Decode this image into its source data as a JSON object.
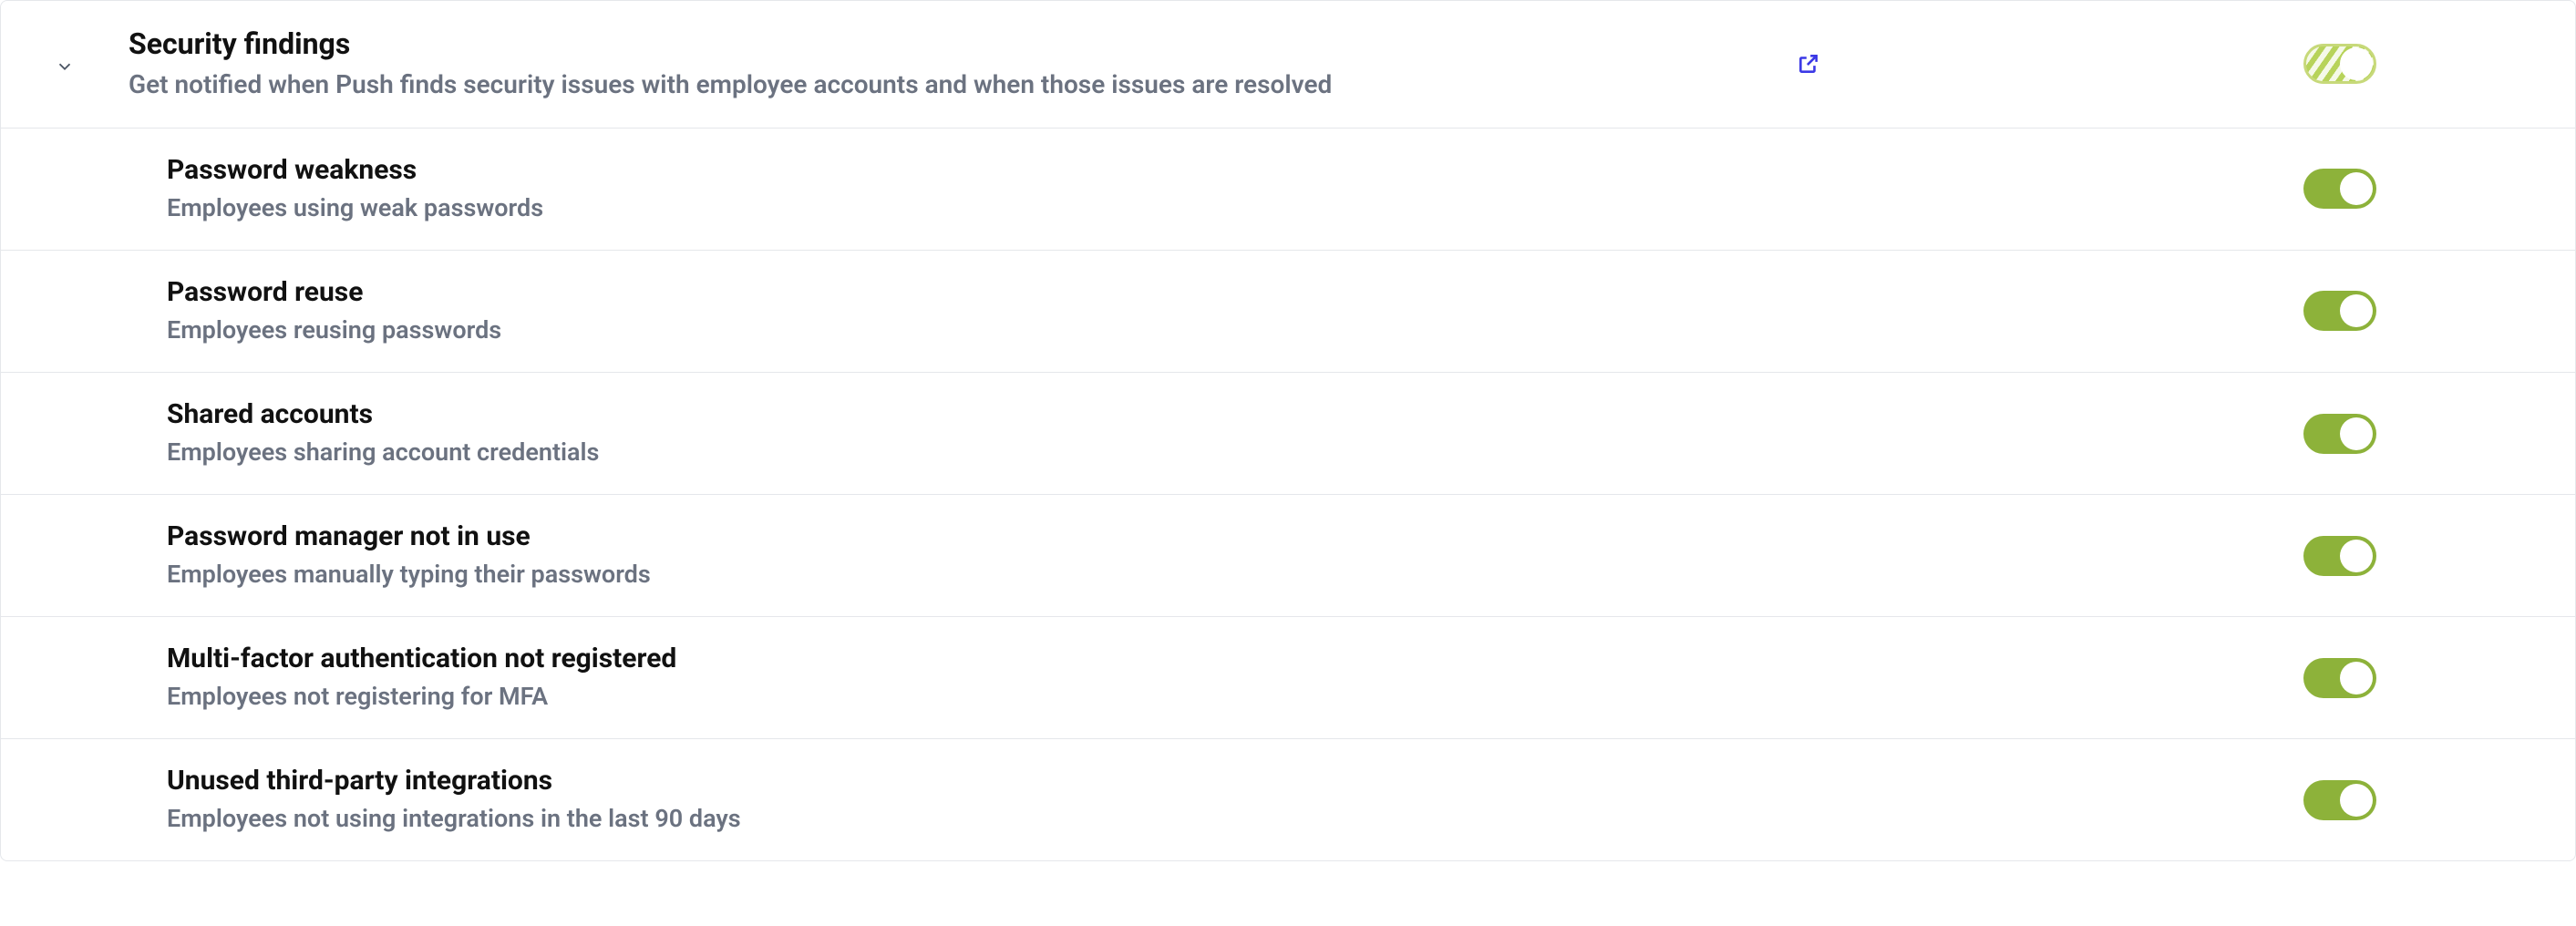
{
  "section": {
    "title": "Security findings",
    "description": "Get notified when Push finds security issues with employee accounts and when those issues are resolved",
    "toggle_state": "partial",
    "external_link": true
  },
  "items": [
    {
      "title": "Password weakness",
      "description": "Employees using weak passwords",
      "enabled": true
    },
    {
      "title": "Password reuse",
      "description": "Employees reusing passwords",
      "enabled": true
    },
    {
      "title": "Shared accounts",
      "description": "Employees sharing account credentials",
      "enabled": true
    },
    {
      "title": "Password manager not in use",
      "description": "Employees manually typing their passwords",
      "enabled": true
    },
    {
      "title": "Multi-factor authentication not registered",
      "description": "Employees not registering for MFA",
      "enabled": true
    },
    {
      "title": "Unused third-party integrations",
      "description": "Employees not using integrations in the last 90 days",
      "enabled": true
    }
  ]
}
